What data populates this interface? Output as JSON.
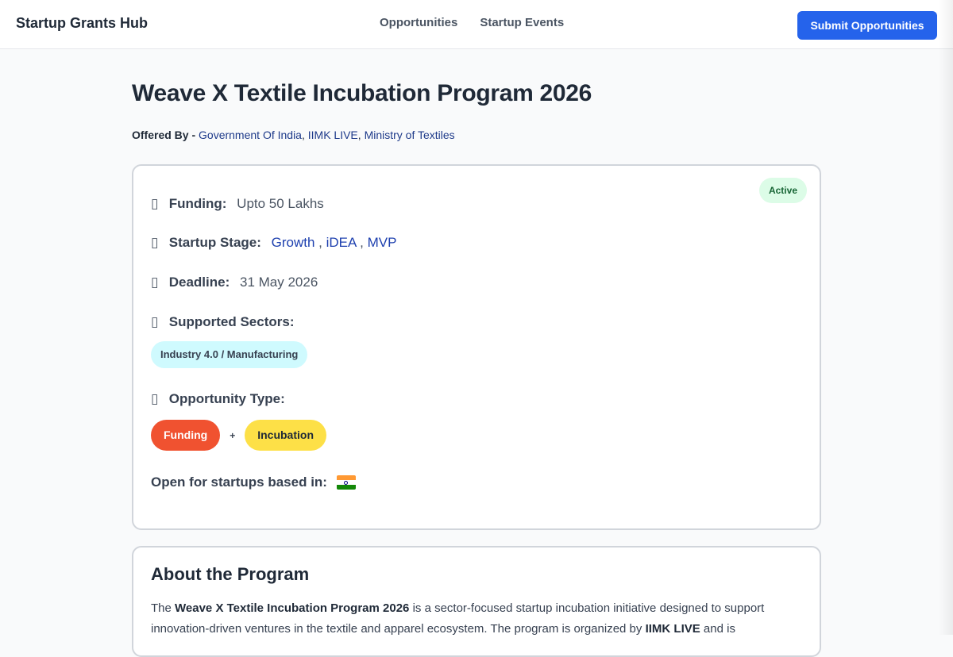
{
  "header": {
    "brand": "Startup Grants Hub",
    "nav": [
      "Opportunities",
      "Startup Events"
    ],
    "submit_label": "Submit Opportunities"
  },
  "program": {
    "title": "Weave X Textile Incubation Program 2026",
    "offered_by_label": "Offered By -",
    "offered_by": [
      "Government Of India",
      "IIMK LIVE",
      "Ministry of Textiles"
    ],
    "status": "Active",
    "funding_label": "Funding:",
    "funding_value": "Upto 50 Lakhs",
    "stage_label": "Startup Stage:",
    "stages": [
      "Growth",
      "iDEA",
      "MVP"
    ],
    "deadline_label": "Deadline:",
    "deadline_value": "31 May 2026",
    "sectors_label": "Supported Sectors:",
    "sectors": [
      "Industry 4.0 / Manufacturing"
    ],
    "type_label": "Opportunity Type:",
    "types": [
      "Funding",
      "Incubation"
    ],
    "type_joiner": "+",
    "location_label": "Open for startups based in:",
    "location_country": "India"
  },
  "about": {
    "heading": "About the Program",
    "p1": "The ",
    "p1_bold": "Weave X Textile Incubation Program 2026",
    "p2": " is a sector-focused startup incubation initiative designed to support innovation-driven ventures in the textile and apparel ecosystem. The program is organized by ",
    "p2_bold": "IIMK LIVE",
    "p3": " and is"
  },
  "icons": {
    "row_glyph": "▯",
    "flag": "india-flag-icon"
  },
  "colors": {
    "primary": "#2563eb",
    "link": "#1e3a8a",
    "active_bg": "#dcfce7",
    "sector_bg": "#cffafe",
    "funding_pill": "#f05230",
    "incubation_pill": "#fde047"
  }
}
